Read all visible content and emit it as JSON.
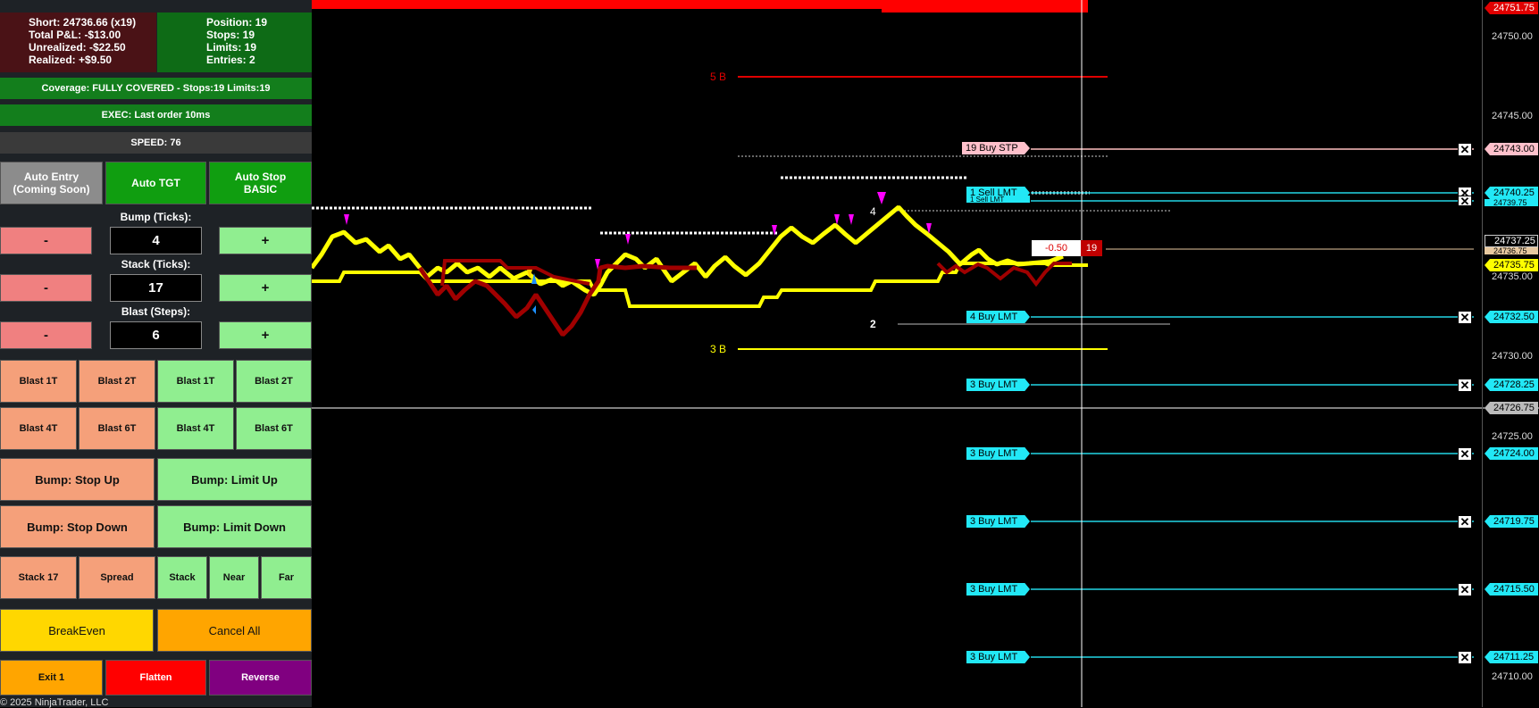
{
  "stats": {
    "short": "Short: 24736.66 (x19)",
    "total_pnl": "Total P&L: -$13.00",
    "unrealized": "Unrealized: -$22.50",
    "realized": "Realized: +$9.50",
    "position": "Position: 19",
    "stops": "Stops: 19",
    "limits": "Limits: 19",
    "entries": "Entries: 2"
  },
  "coverage": "Coverage: FULLY COVERED - Stops:19 Limits:19",
  "exec": "EXEC: Last order 10ms",
  "speed": "SPEED: 76",
  "auto": {
    "entry": "Auto Entry\n(Coming Soon)",
    "tgt": "Auto TGT",
    "stop": "Auto Stop\nBASIC"
  },
  "bump": {
    "label": "Bump (Ticks):",
    "value": "4"
  },
  "stack": {
    "label": "Stack (Ticks):",
    "value": "17"
  },
  "blast": {
    "label": "Blast (Steps):",
    "value": "6"
  },
  "minus": "-",
  "plus": "+",
  "blast_buttons": [
    "Blast 1T",
    "Blast 2T",
    "Blast 1T",
    "Blast 2T",
    "Blast 4T",
    "Blast 6T",
    "Blast 4T",
    "Blast 6T"
  ],
  "bump_buttons": {
    "stop_up": "Bump: Stop Up",
    "limit_up": "Bump: Limit Up",
    "stop_down": "Bump: Stop Down",
    "limit_down": "Bump: Limit Down"
  },
  "stack_row": [
    "Stack 17",
    "Spread",
    "Stack",
    "Near",
    "Far"
  ],
  "breakeven": "BreakEven",
  "cancel_all": "Cancel All",
  "exit1": "Exit 1",
  "flatten": "Flatten",
  "reverse": "Reverse",
  "copyright": "© 2025 NinjaTrader, LLC",
  "axis_ticks": [
    "24750.00",
    "24745.00",
    "24735.00",
    "24730.00",
    "24725.00",
    "24710.00"
  ],
  "price_labels": {
    "top": "24751.75",
    "stp": "24743.00",
    "sell1": "24740.25",
    "sell2": "24739.75",
    "last": "24737.25",
    "avg": "24736.75",
    "yellow": "24735.75",
    "buy4": "24732.50",
    "buy3a": "24728.25",
    "cross": "24726.75",
    "buy3b": "24724.00",
    "buy3c": "24719.75",
    "buy3d": "24715.50",
    "buy3e": "24711.25"
  },
  "orders": {
    "stp": "19  Buy STP",
    "sell1": "1  Sell LMT",
    "sell2": "1  Sell LMT",
    "buy4": "4  Buy LMT",
    "buy3": "3  Buy LMT",
    "close": "✕"
  },
  "levels": {
    "five_b": "5 B",
    "three_b": "3 B"
  },
  "position_marker": {
    "pnl": "-0.50",
    "qty": "19"
  },
  "chart_marks": {
    "four": "4",
    "two": "2"
  }
}
